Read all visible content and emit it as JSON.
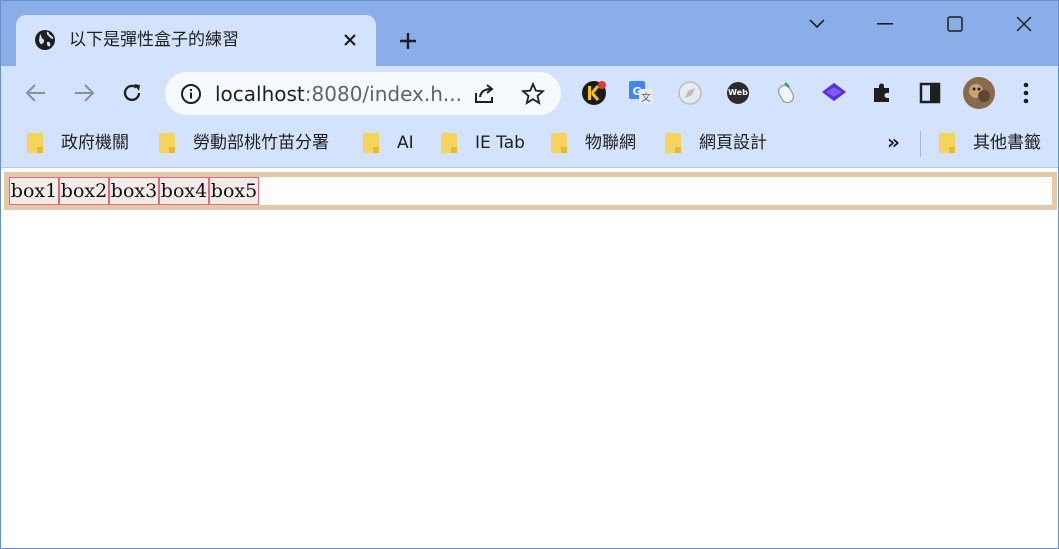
{
  "tab": {
    "title": "以下是彈性盒子的練習",
    "icon": "globe-icon"
  },
  "window_controls": {
    "tab_search": "chevron-down-icon",
    "minimize": "minimize-icon",
    "maximize": "maximize-icon",
    "close": "close-icon"
  },
  "toolbar": {
    "url_host": "localhost",
    "url_rest": ":8080/index.h...",
    "extensions": [
      "keepass-icon",
      "google-translate-icon",
      "compass-icon",
      "web-chatgpt-icon",
      "mouse-icon",
      "layers-icon",
      "puzzle-icon",
      "side-panel-icon",
      "profile-avatar",
      "menu-icon"
    ]
  },
  "bookmarks": {
    "items": [
      {
        "label": "政府機關"
      },
      {
        "label": "勞動部桃竹苗分署"
      },
      {
        "label": "AI"
      },
      {
        "label": "IE Tab"
      },
      {
        "label": "物聯網"
      },
      {
        "label": "網頁設計"
      }
    ],
    "more": "»",
    "other": "其他書籤"
  },
  "page": {
    "boxes": [
      "box1",
      "box2",
      "box3",
      "box4",
      "box5"
    ]
  },
  "colors": {
    "tabstrip": "#8aaee8",
    "toolbar": "#d3e3fd",
    "container_border": "#e4c8aa",
    "box_border": "#e06a82",
    "box_bg": "#f3ece8"
  }
}
